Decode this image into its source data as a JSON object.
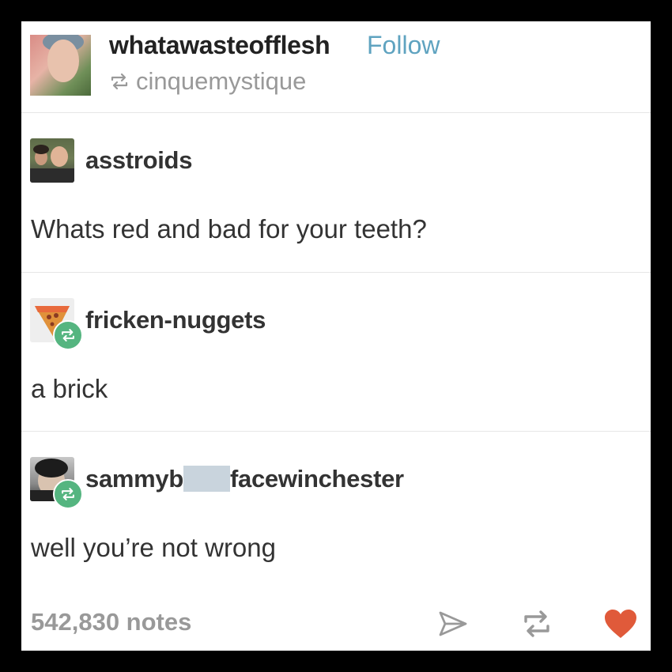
{
  "post": {
    "poster_username": "whatawasteofflesh",
    "follow_label": "Follow",
    "reblogged_from": "cinquemystique",
    "entries": [
      {
        "username": "asstroids",
        "text": "Whats red and bad for your teeth?"
      },
      {
        "username": "fricken-nuggets",
        "text": "a brick"
      },
      {
        "username_prefix": "sammyb",
        "username_suffix": "facewinchester",
        "text": "well you’re not wrong"
      }
    ],
    "notes": "542,830 notes"
  },
  "icons": {
    "reblog": "reblog-icon",
    "share": "share-icon",
    "like": "heart-icon"
  },
  "colors": {
    "follow": "#5fa3c0",
    "reblog_badge": "#55b580",
    "like": "#e05a3a"
  }
}
